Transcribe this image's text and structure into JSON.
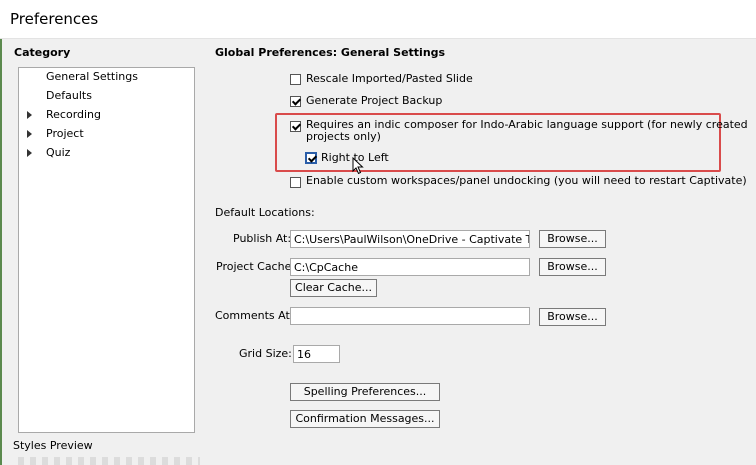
{
  "window": {
    "title": "Preferences"
  },
  "category": {
    "heading": "Category",
    "items": [
      {
        "label": "General Settings",
        "expandable": false
      },
      {
        "label": "Defaults",
        "expandable": false
      },
      {
        "label": "Recording",
        "expandable": true
      },
      {
        "label": "Project",
        "expandable": true
      },
      {
        "label": "Quiz",
        "expandable": true
      }
    ],
    "styles_preview": "Styles Preview"
  },
  "settings": {
    "heading": "Global Preferences: General Settings",
    "options": [
      {
        "label": "Rescale Imported/Pasted Slide",
        "checked": false
      },
      {
        "label": "Generate Project Backup",
        "checked": true
      },
      {
        "label_line1": "Requires an indic composer for Indo-Arabic language support (for newly created",
        "label_line2": "projects only)",
        "checked": true
      },
      {
        "label": "Right to Left",
        "checked": true
      },
      {
        "label": "Enable custom workspaces/panel undocking (you will need to restart Captivate)",
        "checked": false
      }
    ],
    "default_locations_label": "Default Locations:",
    "publish_at": {
      "label": "Publish At:",
      "value": "C:\\Users\\PaulWilson\\OneDrive - Captivate Teach",
      "button": "Browse..."
    },
    "project_cache": {
      "label": "Project Cache:",
      "value": "C:\\CpCache",
      "button": "Browse...",
      "clear_button": "Clear Cache..."
    },
    "comments_at": {
      "label": "Comments At:",
      "value": "",
      "button": "Browse..."
    },
    "grid_size": {
      "label": "Grid Size:",
      "value": "16"
    },
    "spelling_button": "Spelling Preferences...",
    "confirmation_button": "Confirmation Messages..."
  },
  "colors": {
    "highlight": "#d94b4b"
  }
}
